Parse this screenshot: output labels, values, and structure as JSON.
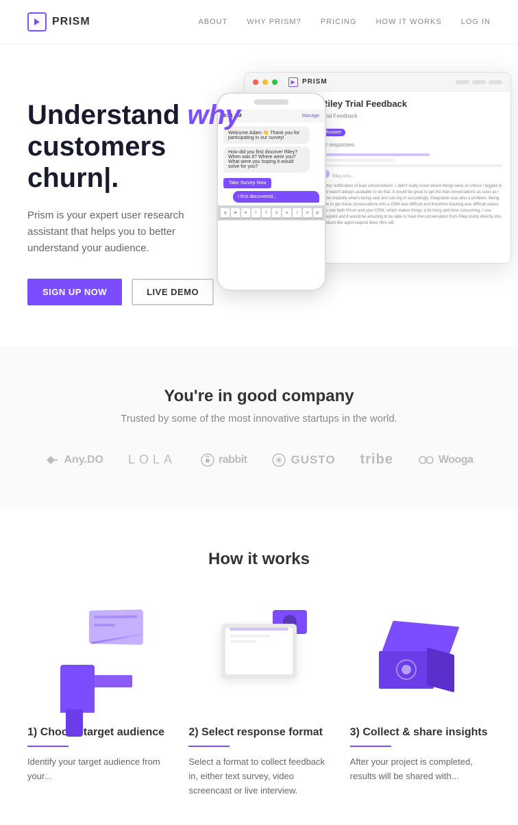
{
  "nav": {
    "logo_text": "PRISM",
    "links": [
      {
        "label": "ABOUT",
        "href": "#"
      },
      {
        "label": "WHY PRISM?",
        "href": "#"
      },
      {
        "label": "PRICING",
        "href": "#"
      },
      {
        "label": "HOW IT WORKS",
        "href": "#"
      },
      {
        "label": "LOG IN",
        "href": "#"
      }
    ]
  },
  "hero": {
    "headline_part1": "Understand ",
    "headline_italic": "why",
    "headline_part2": " customers churn|.",
    "description": "Prism is your expert user research assistant that helps you to better understand your audience.",
    "btn_signup": "SIGN UP NOW",
    "btn_demo": "LIVE DEMO",
    "mockup": {
      "desktop_title": "Riley Trial Feedback",
      "desktop_subtitle": "Trial Feedback",
      "responses": "28 responses",
      "feedback_text": "Better notification of lead conversations. I didn't really know where things were or unless I logged in and wasn't always available to do that. It would be great to get the trial conversations as soon as I know instantly what's being said and can log in accordingly. Integration was also a problem. Being able to get these conversations into a CRM was difficult and therefore tracking was difficult unless you use both Prism and your CRM, which makes things a bit tricky and time consuming. I use Firepoint and it would be amazing to be able to have the conversation from Riley dump directly into it. Much like agent legend does (this will"
    }
  },
  "social_proof": {
    "heading": "You're in good company",
    "subheading": "Trusted by some of the most innovative startups in the world.",
    "logos": [
      {
        "name": "Any.DO",
        "class": "anydo"
      },
      {
        "name": "LOLA",
        "class": "lola"
      },
      {
        "name": "rabbit",
        "class": "rabbit"
      },
      {
        "name": "GUSTO",
        "class": "gusto"
      },
      {
        "name": "tribe",
        "class": "tribe"
      },
      {
        "name": "Wooga",
        "class": "wooga"
      }
    ]
  },
  "how_it_works": {
    "heading": "How it works",
    "steps": [
      {
        "number": "1)",
        "title": "Choose target audience",
        "description": "Identify your target audience from your..."
      },
      {
        "number": "2)",
        "title": "Select response format",
        "description": "Select a format to collect feedback in, either text survey, video screencast or live interview."
      },
      {
        "number": "3)",
        "title": "Collect & share insights",
        "description": "After your project is completed, results will be shared with..."
      }
    ]
  }
}
